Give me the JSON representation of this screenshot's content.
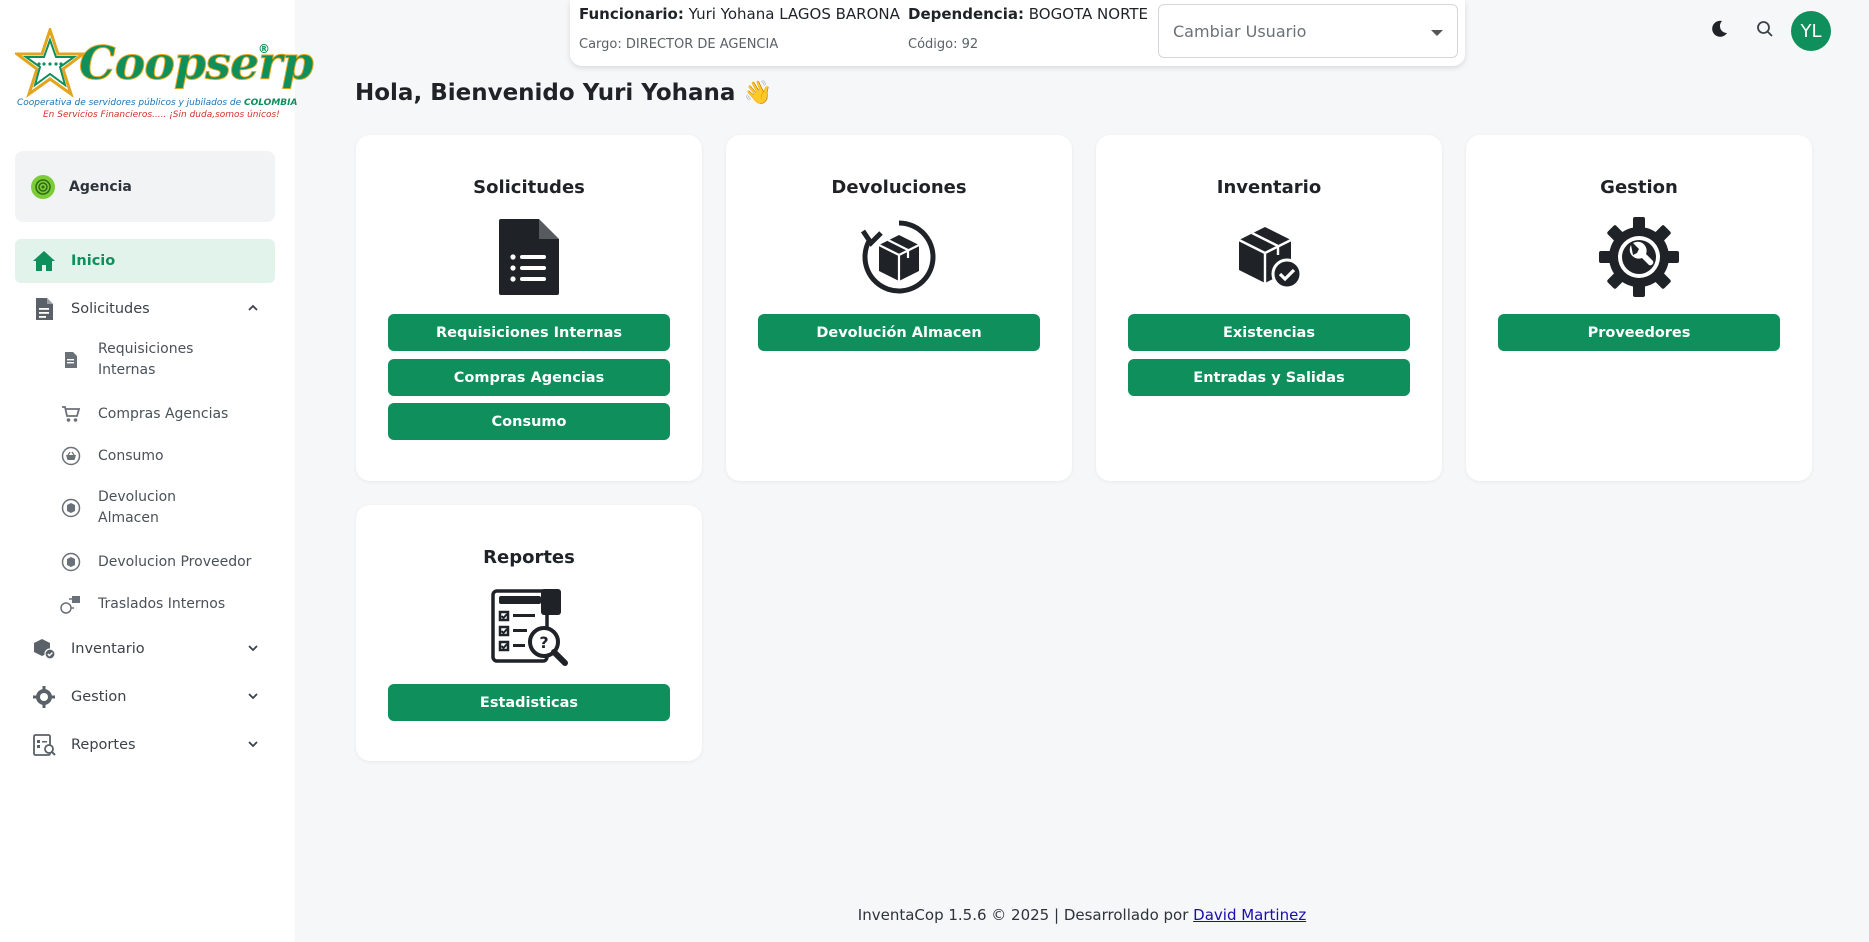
{
  "logo": {
    "brand": "Coopserp",
    "registered": "®",
    "tagline_prefix": "Cooperativa de servidores públicos y jubilados de ",
    "tagline_country": "COLOMBIA",
    "slogan": "En Servicios Financieros..... ¡Sin duda,somos únicos!"
  },
  "sidebar": {
    "agency_label": "Agencia",
    "nav": {
      "inicio": "Inicio",
      "solicitudes": "Solicitudes",
      "inventario": "Inventario",
      "gestion": "Gestion",
      "reportes": "Reportes"
    },
    "sub": {
      "requisiciones_1": "Requisiciones",
      "requisiciones_2": "Internas",
      "compras": "Compras Agencias",
      "consumo": "Consumo",
      "devolucion_almacen_1": "Devolucion",
      "devolucion_almacen_2": "Almacen",
      "devolucion_proveedor": "Devolucion Proveedor",
      "traslados": "Traslados Internos"
    }
  },
  "header": {
    "funcionario_label": "Funcionario:",
    "funcionario_value": "Yuri Yohana LAGOS BARONA",
    "cargo": "Cargo: DIRECTOR DE AGENCIA",
    "dependencia_label": "Dependencia:",
    "dependencia_value": "BOGOTA NORTE",
    "codigo": "Código: 92",
    "select_placeholder": "Cambiar Usuario",
    "avatar_initials": "YL"
  },
  "greeting": "Hola, Bienvenido Yuri Yohana 👋",
  "cards": {
    "solicitudes": {
      "title": "Solicitudes",
      "buttons": [
        "Requisiciones Internas",
        "Compras Agencias",
        "Consumo"
      ]
    },
    "devoluciones": {
      "title": "Devoluciones",
      "buttons": [
        "Devolución Almacen"
      ]
    },
    "inventario": {
      "title": "Inventario",
      "buttons": [
        "Existencias",
        "Entradas y Salidas"
      ]
    },
    "gestion": {
      "title": "Gestion",
      "buttons": [
        "Proveedores"
      ]
    },
    "reportes": {
      "title": "Reportes",
      "buttons": [
        "Estadisticas"
      ]
    }
  },
  "footer": {
    "text": "InventaCop 1.5.6 © 2025 | Desarrollado por ",
    "link": "David Martinez"
  },
  "colors": {
    "accent": "#0e8f5b",
    "active_bg": "#e2f3ec",
    "background": "#f6f7f9",
    "icon_dark": "#1f2328"
  }
}
